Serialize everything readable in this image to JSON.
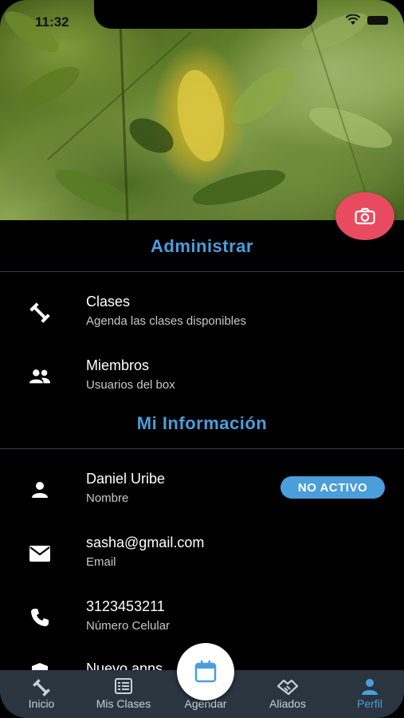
{
  "status_bar": {
    "time": "11:32"
  },
  "sections": {
    "admin_title": "Administrar",
    "info_title": "Mi Información"
  },
  "admin_items": [
    {
      "title": "Clases",
      "subtitle": "Agenda las clases disponibles",
      "icon": "dumbbell-icon"
    },
    {
      "title": "Miembros",
      "subtitle": "Usuarios del box",
      "icon": "group-icon"
    }
  ],
  "info_items": [
    {
      "title": "Daniel Uribe",
      "subtitle": "Nombre",
      "icon": "person-icon"
    },
    {
      "title": "sasha@gmail.com",
      "subtitle": "Email",
      "icon": "email-icon"
    },
    {
      "title": "3123453211",
      "subtitle": "Número Celular",
      "icon": "phone-icon"
    },
    {
      "title": "Nuevo anns",
      "subtitle": "",
      "icon": "shield-icon"
    }
  ],
  "status_badge": "NO ACTIVO",
  "nav": [
    {
      "label": "Inicio",
      "icon": "dumbbell-icon"
    },
    {
      "label": "Mis Clases",
      "icon": "list-icon"
    },
    {
      "label": "Agendar",
      "icon": "calendar-icon"
    },
    {
      "label": "Aliados",
      "icon": "handshake-icon"
    },
    {
      "label": "Perfil",
      "icon": "person-icon",
      "active": true
    }
  ],
  "colors": {
    "accent": "#4a9edb",
    "camera": "#e84a5f",
    "nav_bg": "#2a3540"
  }
}
